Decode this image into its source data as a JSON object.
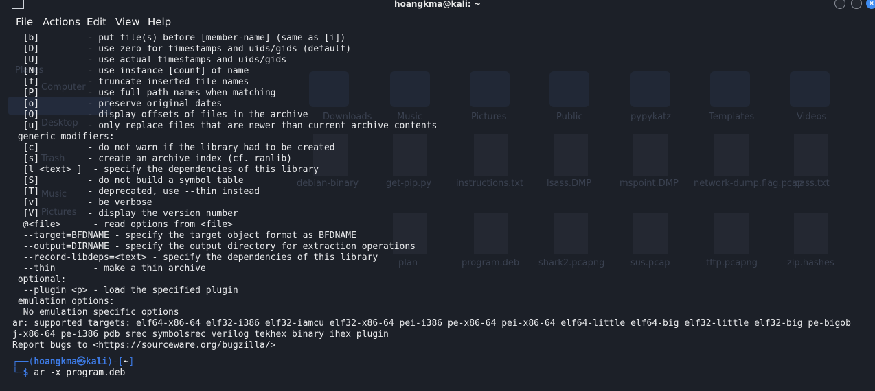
{
  "window": {
    "title": "hoangkma@kali: ~"
  },
  "menu": [
    "File",
    "Actions",
    "Edit",
    "View",
    "Help"
  ],
  "output_lines": [
    "  [b]         - put file(s) before [member-name] (same as [i])",
    "  [D]         - use zero for timestamps and uids/gids (default)",
    "  [U]         - use actual timestamps and uids/gids",
    "  [N]         - use instance [count] of name",
    "  [f]         - truncate inserted file names",
    "  [P]         - use full path names when matching",
    "  [o]         - preserve original dates",
    "  [O]         - display offsets of files in the archive",
    "  [u]         - only replace files that are newer than current archive contents",
    " generic modifiers:",
    "  [c]         - do not warn if the library had to be created",
    "  [s]         - create an archive index (cf. ranlib)",
    "  [l <text> ]  - specify the dependencies of this library",
    "  [S]         - do not build a symbol table",
    "  [T]         - deprecated, use --thin instead",
    "  [v]         - be verbose",
    "  [V]         - display the version number",
    "  @<file>      - read options from <file>",
    "  --target=BFDNAME - specify the target object format as BFDNAME",
    "  --output=DIRNAME - specify the output directory for extraction operations",
    "  --record-libdeps=<text> - specify the dependencies of this library",
    "  --thin       - make a thin archive",
    " optional:",
    "  --plugin <p> - load the specified plugin",
    " emulation options:",
    "  No emulation specific options",
    "ar: supported targets: elf64-x86-64 elf32-i386 elf32-iamcu elf32-x86-64 pei-i386 pe-x86-64 pei-x86-64 elf64-little elf64-big elf32-little elf32-big pe-bigob",
    "j-x86-64 pe-i386 pdb srec symbolsrec verilog tekhex binary ihex plugin",
    "Report bugs to <https://sourceware.org/bugzilla/>"
  ],
  "prompt": {
    "frame_top": "┌──(",
    "user": "hoangkma㉿kali",
    "mid": ")-[",
    "dir": "~",
    "end": "]",
    "frame_bottom": "└─",
    "symbol": "$",
    "command": " ar -x program.deb"
  },
  "colors": {
    "prompt": "#3d7be6",
    "text": "#e9eaec",
    "background": "#1c2028"
  },
  "background_files": {
    "folders": [
      "Downloads",
      "Music",
      "Pictures",
      "Public",
      "pypykatz",
      "Templates",
      "Videos"
    ],
    "row2": [
      "debian-binary",
      "get-pip.py",
      "instructions.txt",
      "lsass.DMP",
      "mspoint.DMP",
      "network-dump.flag.pcap",
      "pass.txt"
    ],
    "row3": [
      "plan",
      "program.deb",
      "shark2.pcapng",
      "sus.pcap",
      "tftp.pcapng",
      "zip.hashes"
    ],
    "sidebar": [
      "Computer",
      "Desktop",
      "Trash",
      "Music",
      "Pictures"
    ]
  }
}
